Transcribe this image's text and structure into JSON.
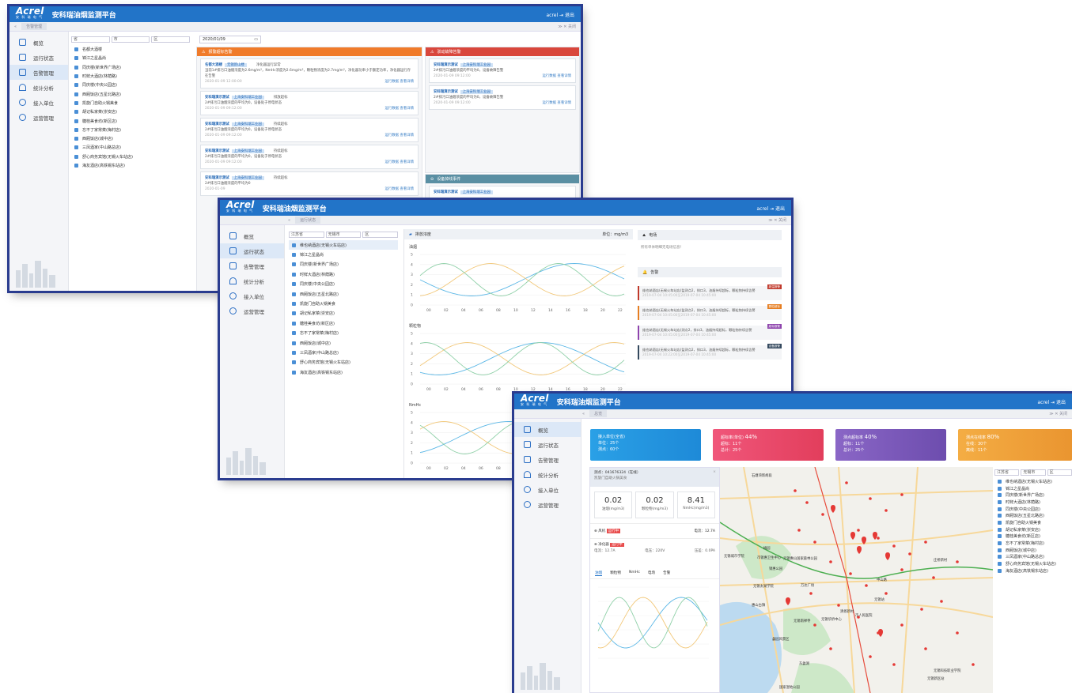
{
  "app": {
    "logo": "Acrel",
    "logo_sub": "安 科 瑞 电 气",
    "title": "安科瑞油烟监测平台",
    "user": "acrel",
    "logout": "退出",
    "back": "返回"
  },
  "colors": {
    "header": "#2274c8",
    "accent_orange": "#f07b2a",
    "accent_red": "#d9473c",
    "accent_teal": "#5a8fa3"
  },
  "sidebar": [
    {
      "label": "概览",
      "icon": "monitor-icon"
    },
    {
      "label": "运行状态",
      "icon": "home-icon"
    },
    {
      "label": "告警管理",
      "icon": "alarm-list-icon"
    },
    {
      "label": "统计分析",
      "icon": "wifi-icon"
    },
    {
      "label": "接入单位",
      "icon": "link-icon"
    },
    {
      "label": "运营管理",
      "icon": "settings-icon"
    }
  ],
  "shot1": {
    "tab": "告警管理",
    "tab_right": "≫  ✕ 关闭",
    "selects": [
      "省",
      "市",
      "区"
    ],
    "date": "2020/01/09",
    "restaurants": [
      "名都大酒楼",
      "锦江之星晶尚",
      "同庆楼(新世界广场店)",
      "时鲜大酒店(林荫路)",
      "同庆楼(中央公园店)",
      "西厢饭店(五星北路店)",
      "凯旋门自助火锅美食",
      "胡记私家菜(崇安店)",
      "糖桂美食坊(新区店)",
      "忘不了家常菜(梅村店)",
      "西厢饭店(城中店)",
      "三凤酒家(中山路总店)",
      "舒心商务宾馆(无锡火车站店)",
      "海友酒店(高铁锡东站店)"
    ],
    "alarm_header": "报警超标告警",
    "fault_header": "驳动故障告警",
    "offline_header": "设备掉线事件",
    "alarm_cards": [
      {
        "title": "名都大酒楼",
        "tag": "无锡新山楼",
        "status": "净化器运行异常",
        "desc": "当前1#排污口油烟浓度为2.6mg/m³，NmHc浓度为2.6mg/m³，颗粒物浓度为2.7mg/m³，净化器功率小于额定功率，净化器运行存在告警",
        "date": "2020-01-09 12:00:00",
        "act1": "运行数据",
        "act2": "查看详情"
      },
      {
        "title": "安科瑞演示测试",
        "tag": "上海安科瑞工业园",
        "status": "排放超标",
        "desc": "2#排污口油烟浓度的平均为0，设备处于停电状态",
        "date": "2020-01-09 09:12:00",
        "act1": "运行数据",
        "act2": "查看详情"
      },
      {
        "title": "安科瑞演示测试",
        "tag": "上海安科瑞工业园",
        "status": "持续超标",
        "desc": "2#排污口油烟浓度的平均为0，设备处于停电状态",
        "date": "2020-01-09 09:12:00",
        "act1": "运行数据",
        "act2": "查看详情"
      },
      {
        "title": "安科瑞演示测试",
        "tag": "上海安科瑞工业园",
        "status": "持续超标",
        "desc": "2#排污口油烟浓度的平均为0，设备处于停电状态",
        "date": "2020-01-09 09:12:00",
        "act1": "运行数据",
        "act2": "查看详情"
      },
      {
        "title": "安科瑞演示测试",
        "tag": "上海安科瑞工业园",
        "status": "持续超标",
        "desc": "2#排污口油烟浓度的平均为0",
        "date": "2020-01-09",
        "act1": "运行数据",
        "act2": "查看详情"
      }
    ],
    "fault_cards": [
      {
        "title": "安科瑞演示测试",
        "tag": "上海安科瑞工业园",
        "desc": "2#排污口油烟浓度的平均为0，设备故障告警",
        "date": "2020-01-09 09:12:00",
        "act1": "运行数据",
        "act2": "查看详情"
      },
      {
        "title": "安科瑞演示测试",
        "tag": "上海安科瑞工业园",
        "desc": "2#排污口油烟浓度的平均为0，设备故障告警",
        "date": "2020-01-09 09:12:00",
        "act1": "运行数据",
        "act2": "查看详情"
      }
    ],
    "offline_card": {
      "title": "安科瑞演示测试",
      "tag": "上海安科瑞工业园"
    }
  },
  "shot2": {
    "tab": "运行状态",
    "selects": [
      "江苏省",
      "无锡市",
      "区"
    ],
    "restaurants": [
      "维也纳酒店(无锡火车站店)",
      "锦江之星晶尚",
      "同庆楼(新世界广场店)",
      "时鲜大酒店(林荫路)",
      "同庆楼(中央公园店)",
      "西厢饭店(五星北路店)",
      "凯旋门自助火锅美食",
      "胡记私家菜(崇安店)",
      "糖桂美食坊(新区店)",
      "忘不了家常菜(梅村店)",
      "西厢饭店(城中店)",
      "三凤酒家(中山路总店)",
      "舒心商务宾馆(无锡火车站店)",
      "海友酒店(高铁锡东站店)"
    ],
    "chart_panel_title": "排放浓度",
    "unit": "单位：mg/m3",
    "power_title": "电场",
    "power_desc": "所有单体明细无电场信息！",
    "alarm_title": "告警",
    "chart_labels": [
      "油烟",
      "颗粒物",
      "NmHc"
    ],
    "y_ticks": [
      "5",
      "4",
      "3",
      "2",
      "1",
      "0"
    ],
    "x_ticks": [
      "00",
      "02",
      "04",
      "06",
      "08",
      "10",
      "12",
      "14",
      "16",
      "18",
      "20",
      "22"
    ],
    "alarms": [
      {
        "type": "超温报警",
        "text": "维也纳酒店(无锡火车站店)监测点2，排口3，油烟持续超标，颗粒物持续告警",
        "date": "2019-07-04 10:45:00至2019-07-04 10:45:00"
      },
      {
        "type": "颗粒超标",
        "text": "维也纳酒店(无锡火车站店)监测点2，排口3，油烟持续超标，颗粒物持续告警",
        "date": "2019-07-04 10:45:00至2019-07-04 10:45:00"
      },
      {
        "type": "超标报警",
        "text": "维也纳酒店(无锡火车站店)测点2，排口3，油烟持续超标，颗粒物持续告警",
        "date": "2019-07-04 10:45:00至2019-07-04 10:45:00"
      },
      {
        "type": "设备报警",
        "text": "维也纳酒店(无锡火车站店)监测点2，排口3，油烟持续超标，颗粒物持续告警",
        "date": "2019-07-04 10:22:00至2019-07-04 10:45:00"
      }
    ]
  },
  "shot3": {
    "tab": "总览",
    "summary": [
      {
        "title": "接入单位(全省)",
        "big": "",
        "l1": "单位：25个",
        "l2": "测点：60个",
        "color": "#2aa0e6"
      },
      {
        "title": "超标率(单位)",
        "big": "44%",
        "l1": "超标：11个",
        "l2": "总计：25个",
        "color": "#ea4a6a"
      },
      {
        "title": "测点超标率",
        "big": "40%",
        "l1": "超标：11个",
        "l2": "总计：25个",
        "color": "#7a58b8"
      },
      {
        "title": "测点在线率",
        "big": "80%",
        "l1": "在线：30个",
        "l2": "离线：11个",
        "color": "#f0a23a"
      }
    ],
    "point": {
      "title": "测点：041676324（在线）",
      "sub": "凯旋门自助火锅美食"
    },
    "gauges": [
      {
        "v": "0.02",
        "l": "油烟(mg/m3)"
      },
      {
        "v": "0.02",
        "l": "颗粒物(mg/m3)"
      },
      {
        "v": "8.41",
        "l": "NmHc(mg/m3)"
      }
    ],
    "fan": {
      "name": "风机",
      "state": "运行中",
      "current": "电流：12.7A"
    },
    "purifier": {
      "name": "净化器",
      "state": "运行中",
      "current": "电流：12.7A",
      "voltage": "电压：220V",
      "pressure": "压差：0.0PA"
    },
    "tabs": [
      "油烟",
      "颗粒物",
      "NmHc",
      "电场",
      "告警"
    ],
    "selects": [
      "江苏省",
      "无锡市",
      "区"
    ],
    "restaurants": [
      "维也纳酒店(无锡火车站店)",
      "锦江之星晶尚",
      "同庆楼(新世界广场店)",
      "时鲜大酒店(林荫路)",
      "同庆楼(中央公园店)",
      "西厢饭店(五星北路店)",
      "凯旋门自助火锅美食",
      "胡记私家菜(崇安店)",
      "糖桂美食坊(新区店)",
      "忘不了家常菜(梅村店)",
      "西厢饭店(城中店)",
      "三凤酒家(中山路总店)",
      "舒心商务宾馆(无锡火车站店)",
      "海友酒店(高铁锡东站店)"
    ],
    "map_labels": [
      "石塘湾新胡段",
      "无锡城市学院",
      "市锡惠卫生中心",
      "无锡太湖学院",
      "锡惠公园",
      "无锡惠山国家森林公园",
      "中山路",
      "惠山古镇",
      "万达广场",
      "蠡园风景区",
      "清扬新村",
      "无锡南禅寺",
      "无锡华侨中心",
      "市人民医院",
      "无锡站",
      "东蠡湖",
      "国家湿地公园",
      "无锡科技职业学院",
      "庄桥新村",
      "梅园",
      "无锡新区站"
    ]
  }
}
